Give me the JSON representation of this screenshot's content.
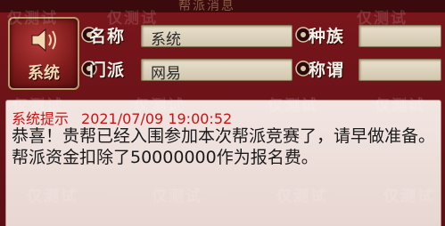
{
  "window": {
    "title": "帮派消息"
  },
  "avatar": {
    "label": "系统",
    "icon": "speaker-icon"
  },
  "info": {
    "name_label": "名称",
    "name_value": "系统",
    "race_label": "种族",
    "race_value": "",
    "sect_label": "门派",
    "sect_value": "网易",
    "title_label": "称谓",
    "title_value": ""
  },
  "message": {
    "sender": "系统提示",
    "timestamp": "2021/07/09 19:00:52",
    "body": "恭喜！贵帮已经入围参加本次帮派竞赛了，请早做准备。帮派资金扣除了50000000作为报名费。"
  },
  "watermark": {
    "text": "仅测试"
  },
  "colors": {
    "panel_bg": "#6a1418",
    "message_red": "#c81414",
    "field_bg": "#e8dfcc"
  }
}
